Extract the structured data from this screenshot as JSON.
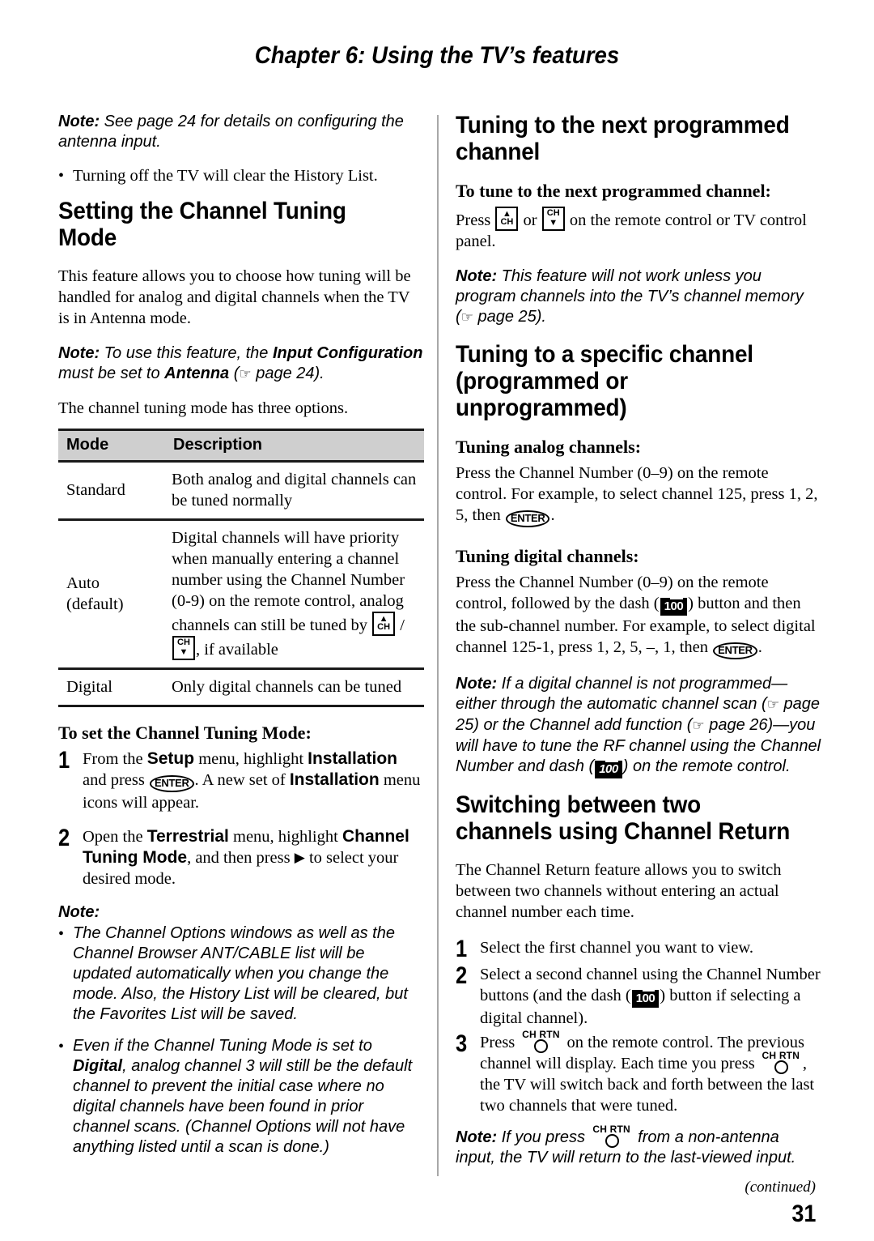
{
  "header": {
    "chapter_title": "Chapter 6: Using the TV’s features"
  },
  "footer": {
    "continued": "(continued)",
    "page_number": "31"
  },
  "icons": {
    "hand_pointer": "☞",
    "ch_up_arrow": "▲",
    "ch_down_arrow": "▼",
    "ch_label": "CH",
    "enter_label": "ENTER",
    "dash_key_label": "100",
    "dash_key_prefix": "1",
    "dash_key_suffix": "00",
    "ch_rtn_label": "CH RTN",
    "right_arrow": "▶",
    "bullet": "•"
  },
  "left_column": {
    "note_antenna": {
      "label": "Note:",
      "text": " See page 24 for details on configuring the antenna input."
    },
    "bullet_history": "Turning off the TV will clear the History List.",
    "heading_setting_mode": "Setting the Channel Tuning Mode",
    "intro_paragraph": "This feature allows you to choose how tuning will be handled for analog and digital channels when the TV is in Antenna mode.",
    "note_input_config": {
      "label": "Note:",
      "part1": " To use this feature, the ",
      "bold1": "Input Configuration",
      "part2": " must be set to ",
      "bold2": "Antenna",
      "part3": " (",
      "part4": " page 24)."
    },
    "three_options_paragraph": "The channel tuning mode has three options.",
    "mode_table": {
      "columns": [
        "Mode",
        "Description"
      ],
      "rows": [
        {
          "mode": "Standard",
          "description": "Both analog and digital channels can be tuned normally"
        },
        {
          "mode_line1": "Auto",
          "mode_line2": "(default)",
          "description_part1": "Digital channels will have priority when manually entering a channel number using the Channel Number (0-9) on the remote control, analog channels can still be tuned by ",
          "description_separator": " / ",
          "description_part2": ", if available"
        },
        {
          "mode": "Digital",
          "description": "Only digital channels can be tuned"
        }
      ]
    },
    "heading_to_set": "To set the Channel Tuning Mode:",
    "steps": [
      {
        "number": "1",
        "part1": "From the ",
        "bold1": "Setup",
        "part2": " menu, highlight ",
        "bold2": "Installation",
        "part3": " and press ",
        "part4": ". A new set of ",
        "bold3": "Installation",
        "part5": " menu icons will appear."
      },
      {
        "number": "2",
        "part1": "Open the ",
        "bold1": "Terrestrial",
        "part2": " menu, highlight ",
        "bold2": "Channel Tuning Mode",
        "part3": ", and then press ",
        "part4": " to select your desired mode."
      }
    ],
    "note_heading": "Note:",
    "note_bullets": [
      {
        "text": "The Channel Options windows as well as the Channel Browser ANT/CABLE list will be updated automatically when you change the mode. Also, the History List will be cleared, but the Favorites List will be saved."
      },
      {
        "part1": "Even if the Channel Tuning Mode is set to ",
        "bold1": "Digital",
        "part2": ", analog channel 3 will still be the default channel to prevent the initial case where no digital channels have been found in prior channel scans. (Channel Options will not have anything listed until a scan is done.)"
      }
    ]
  },
  "right_column": {
    "heading_next_programmed": "Tuning to the next programmed channel",
    "subheading_to_tune": "To tune to the next programmed channel:",
    "press_line": {
      "part1": "Press ",
      "part2": " or ",
      "part3": " on the remote control or TV control panel."
    },
    "note_program_channels": {
      "label": "Note:",
      "part1": " This feature will not work unless you program channels into the TV’s channel memory (",
      "part2": " page 25)."
    },
    "heading_specific_channel": "Tuning to a specific channel (programmed or unprogrammed)",
    "subheading_analog": "Tuning analog channels:",
    "analog_paragraph": {
      "part1": "Press the Channel Number (0–9) on the remote control. For example, to select channel 125, press 1, 2, 5, then ",
      "part2": "."
    },
    "subheading_digital": "Tuning digital channels:",
    "digital_paragraph": {
      "part1": "Press the Channel Number (0–9) on the remote control, followed by the dash (",
      "part2": ") button and then the sub-channel number. For example, to select digital channel 125-1, press 1, 2, 5, –, 1, then ",
      "part3": "."
    },
    "note_not_programmed": {
      "label": "Note:",
      "part1": " If a digital channel is not programmed—either through the automatic channel scan (",
      "part2": " page 25) or the Channel add function (",
      "part3": " page 26)—you will have to tune the RF channel using the Channel Number and dash (",
      "part4": ") on the remote control."
    },
    "heading_channel_return": "Switching between two channels using Channel Return",
    "channel_return_paragraph": "The Channel Return feature allows you to switch between two channels without entering an actual channel number each time.",
    "steps": [
      {
        "number": "1",
        "text": "Select the first channel you want to view."
      },
      {
        "number": "2",
        "part1": "Select a second channel using the Channel Number buttons (and the dash (",
        "part2": ") button if selecting a digital channel)."
      },
      {
        "number": "3",
        "part1": "Press ",
        "part2": " on the remote control. The previous channel will display. Each time you press ",
        "part3": ", the TV will switch back and forth between the last two channels that were tuned."
      }
    ],
    "note_non_antenna": {
      "label": "Note:",
      "part1": " If you press ",
      "part2": " from a non-antenna input, the TV will return to the last-viewed input."
    }
  }
}
